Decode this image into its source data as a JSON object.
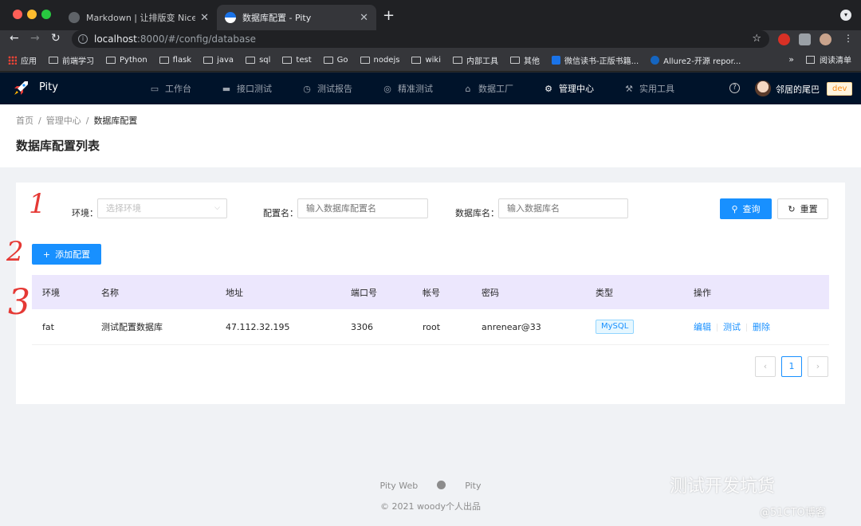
{
  "browser": {
    "tabs": [
      {
        "title": "Markdown | 让排版变 Nice",
        "active": false
      },
      {
        "title": "数据库配置 - Pity",
        "active": true
      }
    ],
    "url_host": "localhost",
    "url_path": ":8000/#/config/database",
    "bookmarks": [
      "应用",
      "前端学习",
      "Python",
      "flask",
      "java",
      "sql",
      "test",
      "Go",
      "nodejs",
      "wiki",
      "内部工具",
      "其他",
      "微信读书-正版书籍...",
      "Allure2-开源 repor..."
    ],
    "bookmarks_more": "»",
    "reading_list": "阅读清单"
  },
  "app": {
    "logo": "Pity",
    "menu": [
      {
        "label": "工作台",
        "icon": "dashboard-icon"
      },
      {
        "label": "接口测试",
        "icon": "folder-icon"
      },
      {
        "label": "测试报告",
        "icon": "clock-icon"
      },
      {
        "label": "精准测试",
        "icon": "target-icon"
      },
      {
        "label": "数据工厂",
        "icon": "factory-icon"
      },
      {
        "label": "管理中心",
        "icon": "gear-icon",
        "active": true
      },
      {
        "label": "实用工具",
        "icon": "tool-icon"
      }
    ],
    "user": "邻居的尾巴",
    "env": "dev"
  },
  "breadcrumb": [
    "首页",
    "管理中心",
    "数据库配置"
  ],
  "page_title": "数据库配置列表",
  "filters": {
    "env_label": "环境：",
    "env_placeholder": "选择环境",
    "name_label": "配置名：",
    "name_placeholder": "输入数据库配置名",
    "db_label": "数据库名：",
    "db_placeholder": "输入数据库名",
    "search_button": "查询",
    "reset_button": "重置"
  },
  "add_button": "添加配置",
  "table": {
    "headers": [
      "环境",
      "名称",
      "地址",
      "端口号",
      "帐号",
      "密码",
      "类型",
      "操作"
    ],
    "rows": [
      {
        "env": "fat",
        "name": "测试配置数据库",
        "host": "47.112.32.195",
        "port": "3306",
        "user": "root",
        "password": "anrenear@33",
        "type": "MySQL",
        "actions": [
          "编辑",
          "测试",
          "删除"
        ]
      }
    ]
  },
  "pagination": {
    "prev": "‹",
    "current": "1",
    "next": "›"
  },
  "annotations": [
    "1",
    "2",
    "3"
  ],
  "footer": {
    "links": [
      "Pity Web",
      "Pity"
    ],
    "copyright": "© 2021 woody个人出品"
  },
  "watermark": {
    "line1": "测试开发坑货",
    "line2": "@51CTO博客"
  },
  "colors": {
    "primary": "#1890ff",
    "nav_bg": "#00132a",
    "table_header": "#ece7fd",
    "annotation": "#e53935"
  }
}
